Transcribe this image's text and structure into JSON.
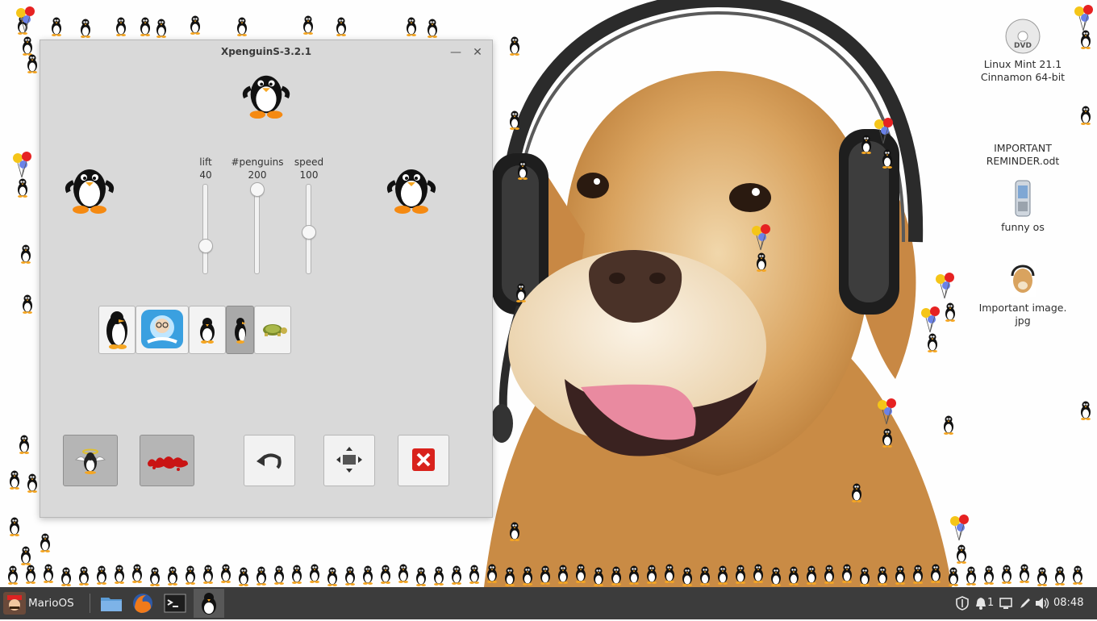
{
  "window": {
    "title": "XpenguinS-3.2.1",
    "minimize_glyph": "—",
    "close_glyph": "✕"
  },
  "sliders": [
    {
      "label": "lift",
      "value": "40",
      "level": 0.27
    },
    {
      "label": "#penguins",
      "value": "200",
      "level": 1.0
    },
    {
      "label": "speed",
      "value": "100",
      "level": 0.45
    }
  ],
  "themes": [
    {
      "name": "big-penguin-theme",
      "selected": false
    },
    {
      "name": "bill-theme",
      "selected": false
    },
    {
      "name": "small-penguin-theme",
      "selected": false
    },
    {
      "name": "classic-penguin-theme",
      "selected": true
    },
    {
      "name": "turtle-theme",
      "selected": false
    }
  ],
  "actions": [
    {
      "name": "angel-toggle-button",
      "icon": "angel-penguin-icon",
      "pressed": true
    },
    {
      "name": "blood-toggle-button",
      "icon": "blood-splat-icon",
      "pressed": true
    },
    {
      "name": "undo-button",
      "icon": "undo-arrow-icon",
      "pressed": false
    },
    {
      "name": "fit-button",
      "icon": "fit-window-icon",
      "pressed": false
    },
    {
      "name": "quit-button",
      "icon": "red-x-icon",
      "pressed": false
    }
  ],
  "desktop_icons": [
    {
      "label": "Linux Mint 21.1\nCinnamon 64-bit",
      "icon": "dvd-icon"
    },
    {
      "label": "IMPORTANT\nREMINDER.odt",
      "icon": "document-icon"
    },
    {
      "label": "funny os",
      "icon": "phone-icon"
    },
    {
      "label": "Important image.\njpg",
      "icon": "image-icon"
    }
  ],
  "taskbar": {
    "menu_label": "MarioOS",
    "apps": [
      "files-icon",
      "firefox-icon",
      "terminal-icon",
      "xpenguins-icon"
    ],
    "workspace_badge": "1",
    "clock": "08:48"
  },
  "colors": {
    "taskbar": "#3c3c3c",
    "window_bg": "#d9d9d9",
    "selected_button": "#a9a9a9",
    "quit_red": "#d9221c"
  }
}
